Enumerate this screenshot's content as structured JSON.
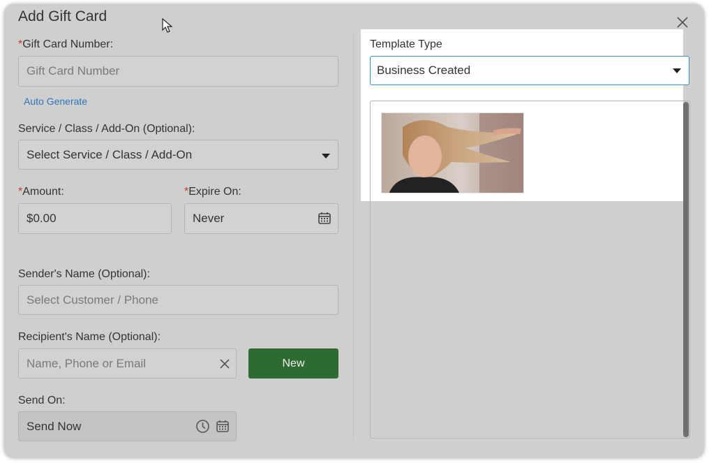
{
  "dialog": {
    "title": "Add Gift Card"
  },
  "gift_card_number": {
    "label": "Gift Card Number:",
    "required_mark": "*",
    "placeholder": "Gift Card Number",
    "value": ""
  },
  "auto_generate": {
    "label": "Auto Generate"
  },
  "service": {
    "label": "Service / Class / Add-On (Optional):",
    "selected": "Select Service / Class / Add-On"
  },
  "amount": {
    "label": "Amount:",
    "required_mark": "*",
    "value": "$0.00"
  },
  "expire_on": {
    "label": "Expire On:",
    "required_mark": "*",
    "value": "Never"
  },
  "sender": {
    "label": "Sender's Name (Optional):",
    "placeholder": "Select Customer / Phone"
  },
  "recipient": {
    "label": "Recipient's Name (Optional):",
    "placeholder": "Name, Phone or Email",
    "new_button_label": "New"
  },
  "send_on": {
    "label": "Send On:",
    "value": "Send Now"
  },
  "template": {
    "label": "Template Type",
    "selected": "Business Created"
  },
  "colors": {
    "dialog_bg": "#cfcfcf",
    "required": "#c0392b",
    "link": "#2d75b8",
    "primary_button": "#2e6b32",
    "focus_border": "#3b8ec4"
  },
  "icons": [
    "close-icon",
    "calendar-icon",
    "clock-icon",
    "clear-icon",
    "chevron-down-icon",
    "cursor-pointer-icon"
  ]
}
